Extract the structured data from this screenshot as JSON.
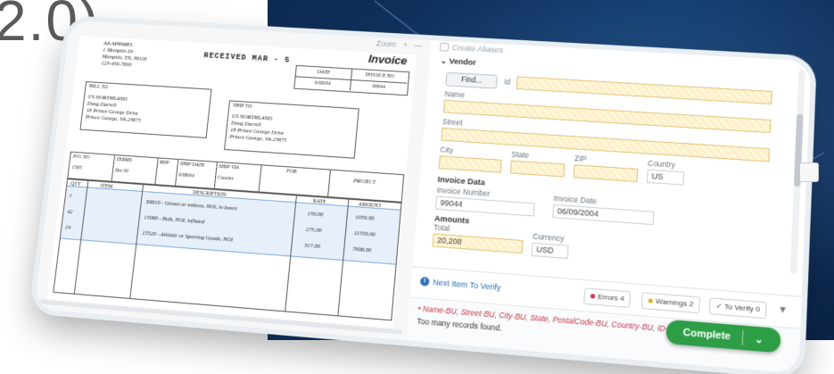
{
  "background": {
    "title_fragment": "2.0)"
  },
  "doc_toolbar": {
    "zoom_label": "Zoom",
    "plus": "+",
    "minus": "—"
  },
  "invoice_image": {
    "company_lines": [
      "AA APPAREL",
      "1 Memphis Dr",
      "Memphis, TN, 38118",
      "123-456-7890"
    ],
    "received_stamp": "RECEIVED MAR - 5",
    "title": "Invoice",
    "date_header": "DATE",
    "invoice_no_header": "INVOICE NO",
    "date_value": "6/09/04",
    "invoice_no_value": "99044",
    "bill_to_label": "BILL TO",
    "bill_to_lines": [
      "US NORTHLAND",
      "Doug Darrell",
      "18 Prince George Drive",
      "Prince George, VA 23875"
    ],
    "ship_to_label": "SHIP TO",
    "ship_to_lines": [
      "US NORTHLAND",
      "Doug Darrell",
      "18 Prince George Drive",
      "Prince George, VA 23875"
    ],
    "meta_headers": [
      "P.O. NO",
      "TERMS",
      "REP",
      "SHIP DATE",
      "SHIP VIA",
      "FOB",
      "PROJECT"
    ],
    "meta_values": [
      "1505",
      "Net 30",
      "",
      "6/08/04",
      "Courier",
      "",
      ""
    ],
    "item_headers": [
      "QTY",
      "ITEM",
      "DESCRIPTION",
      "RATE",
      "AMOUNT"
    ],
    "items": [
      {
        "qty": "7",
        "desc": "X8810 - Gloves or mittens, NOI, in boxes",
        "rate": "150.00",
        "amount": "1050.00"
      },
      {
        "qty": "42",
        "desc": "15080 - Bulk, NOI, inflated",
        "rate": "275.00",
        "amount": "11550.00"
      },
      {
        "qty": "24",
        "desc": "15520 - Athletic or Sporting Goods, NOI",
        "rate": "317.00",
        "amount": "7608.00"
      }
    ]
  },
  "form": {
    "create_aliases": "Create Aliases",
    "vendor_header": "Vendor",
    "find_button": "Find...",
    "id_label": "Id",
    "name_label": "Name",
    "street_label": "Street",
    "city_label": "City",
    "state_label": "State",
    "zip_label": "ZIP",
    "country_label": "Country",
    "country_value": "US",
    "invoice_data_header": "Invoice Data",
    "invoice_number_label": "Invoice Number",
    "invoice_number_value": "99044",
    "invoice_date_label": "Invoice Date",
    "invoice_date_value": "06/09/2004",
    "amounts_header": "Amounts",
    "total_label": "Total",
    "total_value": "20,208",
    "currency_label": "Currency",
    "currency_value": "USD"
  },
  "bottom_bar": {
    "next_item": "Next Item To Verify",
    "errors": "Errors 4",
    "warnings": "Warnings 2",
    "to_verify": "To Verify 0"
  },
  "messages": {
    "fields_line": "Name-BU, Street-BU, City-BU, State, PostalCode-BU, Country-BU, ID-BU",
    "detail": "Too many records found."
  },
  "complete_button": {
    "label": "Complete"
  },
  "colors": {
    "complete_green": "#2e9e46",
    "error_red": "#c2384a",
    "warning_yellow": "#e0b12c",
    "link_blue": "#2c6fb7"
  }
}
